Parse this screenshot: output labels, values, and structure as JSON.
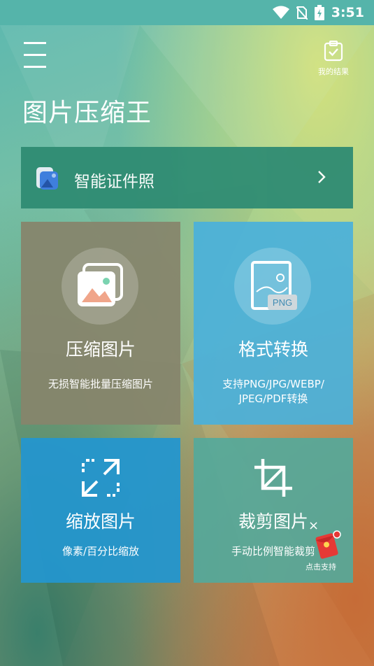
{
  "status_bar": {
    "time": "3:51",
    "icons": [
      "wifi-icon",
      "no-sim-icon",
      "battery-charging-icon"
    ]
  },
  "header": {
    "menu_icon": "hamburger-menu-icon",
    "results_label": "我的结果",
    "results_icon": "clipboard-check-icon",
    "app_title": "图片压缩王"
  },
  "banner": {
    "label": "智能证件照",
    "icon": "id-photo-icon",
    "chevron": "chevron-right-icon"
  },
  "tiles": [
    {
      "title": "压缩图片",
      "subtitle": "无损智能批量压缩图片",
      "icon": "photo-stack-icon"
    },
    {
      "title": "格式转换",
      "subtitle_line1": "支持PNG/JPG/WEBP/",
      "subtitle_line2": "JPEG/PDF转换",
      "icon": "png-file-icon",
      "icon_text": "PNG"
    },
    {
      "title": "缩放图片",
      "subtitle": "像素/百分比缩放",
      "icon": "resize-arrows-icon"
    },
    {
      "title": "裁剪图片",
      "subtitle": "手动比例智能裁剪",
      "icon": "crop-icon"
    }
  ],
  "floating_ad": {
    "label": "点击支持",
    "close": "×",
    "icon": "red-envelope-icon"
  },
  "colors": {
    "status_bar": "#55b4aa",
    "banner": "#2f8c73",
    "tile_compress": "#87846c",
    "tile_format": "#4ab0da",
    "tile_resize": "#2496ce",
    "tile_crop": "#52aa9c"
  }
}
